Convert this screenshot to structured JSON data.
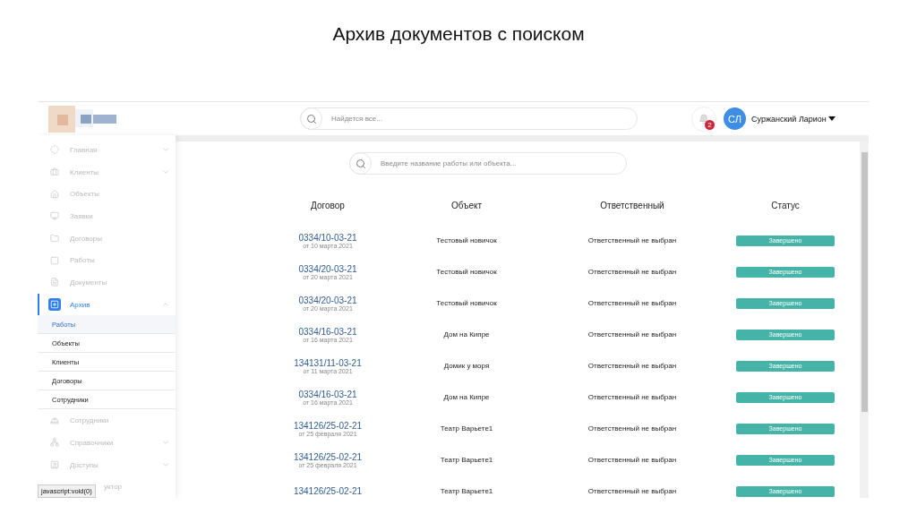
{
  "slide_title": "Архив документов с поиском",
  "header": {
    "search_placeholder": "Найдется все...",
    "notifications": "2",
    "user_initials": "СЛ",
    "user_name": "Суржанский Ларион"
  },
  "sidebar": {
    "items": [
      {
        "kind": "group",
        "label": "Главная",
        "selected": false,
        "expanded": false
      },
      {
        "kind": "group",
        "label": "Клиенты",
        "selected": false,
        "expanded": false
      },
      {
        "kind": "link",
        "label": "Объекты",
        "selected": false
      },
      {
        "kind": "link",
        "label": "Заявки",
        "selected": false
      },
      {
        "kind": "link",
        "label": "Договоры",
        "selected": false
      },
      {
        "kind": "link",
        "label": "Работы",
        "selected": false
      },
      {
        "kind": "link",
        "label": "Документы",
        "selected": false
      },
      {
        "kind": "group",
        "label": "Архив",
        "selected": true,
        "expanded": true,
        "children": [
          {
            "label": "Работы",
            "selected": true
          },
          {
            "label": "Объекты",
            "selected": false
          },
          {
            "label": "Клиенты",
            "selected": false
          },
          {
            "label": "Договоры",
            "selected": false
          },
          {
            "label": "Сотрудники",
            "selected": false
          }
        ]
      },
      {
        "kind": "link",
        "label": "Сотрудники",
        "selected": false
      },
      {
        "kind": "group",
        "label": "Справочники",
        "selected": false,
        "expanded": false
      },
      {
        "kind": "group",
        "label": "Доступы",
        "selected": false,
        "expanded": false
      },
      {
        "kind": "covered",
        "label": "уктор",
        "selected": false
      }
    ]
  },
  "status_tooltip": "javascript:void(0)",
  "archive": {
    "search_placeholder": "Введите название работы или объекта...",
    "columns": [
      "Договор",
      "Объект",
      "Ответственный",
      "Статус"
    ],
    "rows": [
      {
        "contract": "0334/10-03-21",
        "date": "от 10 марта 2021",
        "object": "Тестовый новичок",
        "responsible": "Ответственный не выбран",
        "status": "Завершено"
      },
      {
        "contract": "0334/20-03-21",
        "date": "от 20 марта 2021",
        "object": "Тестовый новичок",
        "responsible": "Ответственный не выбран",
        "status": "Завершено"
      },
      {
        "contract": "0334/20-03-21",
        "date": "от 20 марта 2021",
        "object": "Тестовый новичок",
        "responsible": "Ответственный не выбран",
        "status": "Завершено"
      },
      {
        "contract": "0334/16-03-21",
        "date": "от 16 марта 2021",
        "object": "Дом на Кипре",
        "responsible": "Ответственный не выбран",
        "status": "Завершено"
      },
      {
        "contract": "134131/11-03-21",
        "date": "от 11 марта 2021",
        "object": "Домик у моря",
        "responsible": "Ответственный не выбран",
        "status": "Завершено"
      },
      {
        "contract": "0334/16-03-21",
        "date": "от 16 марта 2021",
        "object": "Дом на Кипре",
        "responsible": "Ответственный не выбран",
        "status": "Завершено"
      },
      {
        "contract": "134126/25-02-21",
        "date": "от 25 февраля 2021",
        "object": "Театр Варьете1",
        "responsible": "Ответственный не выбран",
        "status": "Завершено"
      },
      {
        "contract": "134126/25-02-21",
        "date": "от 25 февраля 2021",
        "object": "Театр Варьете1",
        "responsible": "Ответственный не выбран",
        "status": "Завершено"
      },
      {
        "contract": "134126/25-02-21",
        "object": "Театр Варьете1",
        "responsible": "Ответственный не выбран",
        "status": "Завершено"
      }
    ]
  }
}
